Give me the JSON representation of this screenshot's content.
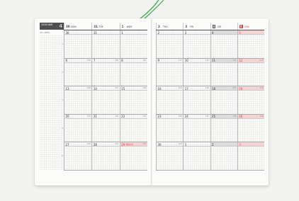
{
  "header": {
    "box_text": "2026 MAR",
    "month_number": "4",
    "subnote": "4/1  APRIL"
  },
  "week_markers": [
    "1",
    "2",
    "3",
    "4",
    "5"
  ],
  "left_days": [
    {
      "num": "30",
      "name": "MON"
    },
    {
      "num": "31",
      "name": "TUE"
    },
    {
      "num": "1",
      "name": "WED"
    }
  ],
  "right_days": [
    {
      "num": "2",
      "name": "THU"
    },
    {
      "num": "3",
      "name": "FRI"
    },
    {
      "num": "4",
      "name": "SAT"
    },
    {
      "num": "5",
      "name": "SUN"
    }
  ],
  "weeks_left": [
    [
      {
        "d": "30",
        "r": ""
      },
      {
        "d": "31",
        "r": ""
      },
      {
        "d": "1",
        "r": ""
      }
    ],
    [
      {
        "d": "6",
        "r": "119"
      },
      {
        "d": "7",
        "r": "120"
      },
      {
        "d": "8",
        "r": "121"
      }
    ],
    [
      {
        "d": "13",
        "r": "126"
      },
      {
        "d": "14",
        "r": "127"
      },
      {
        "d": "15",
        "r": "128"
      }
    ],
    [
      {
        "d": "20",
        "r": "133"
      },
      {
        "d": "21",
        "r": "134"
      },
      {
        "d": "22",
        "r": "135"
      }
    ],
    [
      {
        "d": "27",
        "r": "140"
      },
      {
        "d": "28",
        "r": "141"
      },
      {
        "d": "29",
        "r": "142",
        "note": "昭和の日"
      }
    ]
  ],
  "weeks_right": [
    [
      {
        "d": "2",
        "r": ""
      },
      {
        "d": "3",
        "r": ""
      },
      {
        "d": "4",
        "r": ""
      },
      {
        "d": "5",
        "r": ""
      }
    ],
    [
      {
        "d": "9",
        "r": "122"
      },
      {
        "d": "10",
        "r": "123"
      },
      {
        "d": "11",
        "r": "124"
      },
      {
        "d": "12",
        "r": "125"
      }
    ],
    [
      {
        "d": "16",
        "r": "129"
      },
      {
        "d": "17",
        "r": "130"
      },
      {
        "d": "18",
        "r": "131"
      },
      {
        "d": "19",
        "r": "132"
      }
    ],
    [
      {
        "d": "23",
        "r": "136"
      },
      {
        "d": "24",
        "r": "137"
      },
      {
        "d": "25",
        "r": "138"
      },
      {
        "d": "26",
        "r": "139"
      }
    ],
    [
      {
        "d": "30",
        "r": "143"
      },
      {
        "d": "1",
        "r": ""
      },
      {
        "d": "2",
        "r": ""
      },
      {
        "d": "3",
        "r": ""
      }
    ]
  ],
  "colors": {
    "sunday": "#e23b3b",
    "saturday_band": "#dcdcdc",
    "sunday_band": "#f6d3d3",
    "pen": "#3fae4a"
  }
}
